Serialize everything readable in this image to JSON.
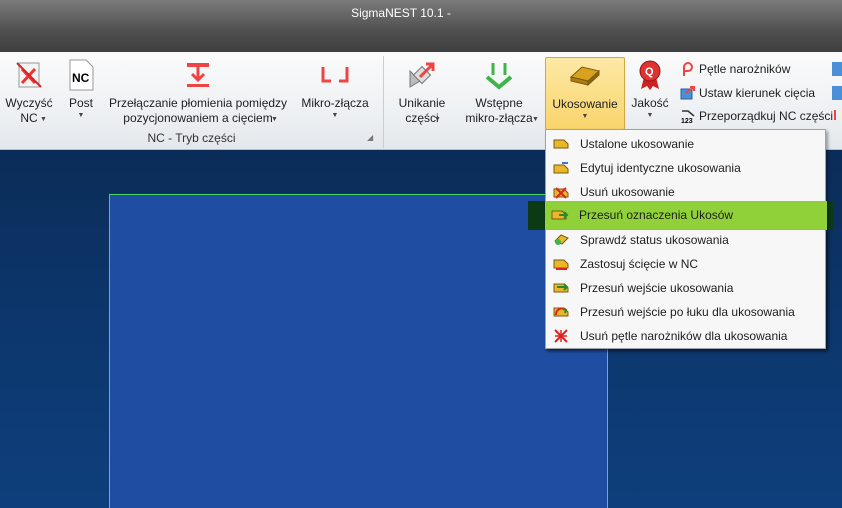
{
  "window": {
    "title": "SigmaNEST 10.1 -"
  },
  "ribbon": {
    "group_caption": "NC - Tryb części",
    "buttons": {
      "wyczysc": {
        "line1": "Wyczyść",
        "line2": "NC"
      },
      "post": {
        "line1": "Post",
        "line2": ""
      },
      "przelaczanie": {
        "line1": "Przełączanie płomienia pomiędzy",
        "line2": "pozycjonowaniem a cięciem"
      },
      "mikro": {
        "line1": "Mikro-złącza",
        "line2": ""
      },
      "unikanie": {
        "line1": "Unikanie",
        "line2": "części"
      },
      "wstepne": {
        "line1": "Wstępne",
        "line2": "mikro-złącza"
      },
      "ukosowanie": {
        "line1": "Ukosowanie",
        "line2": ""
      },
      "jakosc": {
        "line1": "Jakość",
        "line2": ""
      }
    },
    "small_buttons": [
      "Pętle narożników",
      "Ustaw kierunek cięcia",
      "Przeporządkuj NC części"
    ]
  },
  "menu": {
    "items": [
      {
        "label": "Ustalone ukosowanie",
        "icon": "bevel-icon"
      },
      {
        "label": "Edytuj identyczne ukosowania",
        "icon": "bevel-edit-icon"
      },
      {
        "label": "Usuń ukosowanie",
        "icon": "bevel-delete-icon"
      },
      {
        "label": "Przesuń oznaczenia Ukosów",
        "icon": "bevel-move-icon",
        "highlighted": true
      },
      {
        "label": "Sprawdź status ukosowania",
        "icon": "bevel-status-icon"
      },
      {
        "label": "Zastosuj ścięcie w NC",
        "icon": "bevel-apply-icon"
      },
      {
        "label": "Przesuń wejście ukosowania",
        "icon": "bevel-leadin-icon"
      },
      {
        "label": "Przesuń wejście po łuku dla ukosowania",
        "icon": "bevel-arc-leadin-icon"
      },
      {
        "label": "Usuń pętle narożników dla ukosowania",
        "icon": "remove-loops-icon"
      }
    ]
  },
  "colors": {
    "accent": "#f9d46b",
    "highlight": "#90d13a",
    "canvas": "#0c356a",
    "part": "#1f4da1",
    "part_edge": "#47d167"
  }
}
